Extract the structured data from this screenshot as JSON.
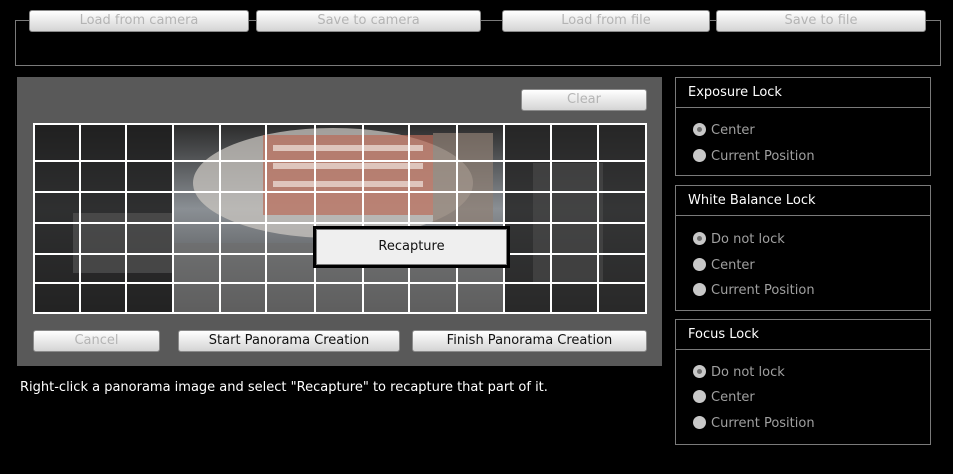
{
  "toolbar": {
    "load_camera": "Load from camera",
    "save_camera": "Save to camera",
    "load_file": "Load from file",
    "save_file": "Save to file"
  },
  "panorama": {
    "clear": "Clear",
    "cancel": "Cancel",
    "start": "Start Panorama Creation",
    "finish": "Finish Panorama Creation",
    "context_menu_item": "Recapture",
    "instruction": "Right-click a panorama image and select \"Recapture\" to recapture that part of it."
  },
  "exposure_lock": {
    "title": "Exposure Lock",
    "options": [
      "Center",
      "Current Position"
    ],
    "selected": "Center"
  },
  "white_balance_lock": {
    "title": "White Balance Lock",
    "options": [
      "Do not lock",
      "Center",
      "Current Position"
    ],
    "selected": "Do not lock"
  },
  "focus_lock": {
    "title": "Focus Lock",
    "options": [
      "Do not lock",
      "Center",
      "Current Position"
    ],
    "selected": "Do not lock"
  }
}
